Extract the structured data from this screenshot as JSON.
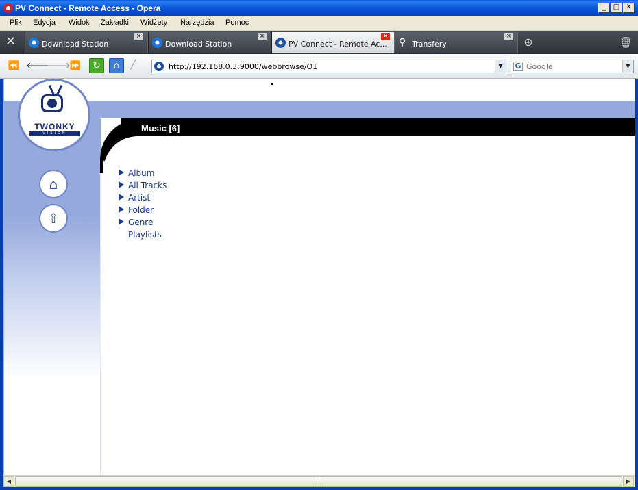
{
  "window": {
    "title": "PV Connect - Remote Access - Opera",
    "minimize_glyph": "_",
    "maximize_glyph": "□",
    "close_glyph": "✕"
  },
  "menu": [
    "Plik",
    "Edycja",
    "Widok",
    "Zakładki",
    "Widżety",
    "Narzędzia",
    "Pomoc"
  ],
  "tabs": [
    {
      "label": "Download Station",
      "icon": "globe-icon",
      "active": false
    },
    {
      "label": "Download Station",
      "icon": "globe-icon",
      "active": false
    },
    {
      "label": "PV Connect - Remote Ac...",
      "icon": "twonky-icon",
      "active": true
    },
    {
      "label": "Transfery",
      "icon": "satellite-icon",
      "active": false
    }
  ],
  "toolbar": {
    "address": "http://192.168.0.3:9000/webbrowse/O1",
    "search_placeholder": "Google",
    "search_engine_letter": "G"
  },
  "page": {
    "logo_text": "TWONKY",
    "logo_sub": "VISION",
    "section_title": "Music [6]",
    "items": [
      {
        "label": "Album",
        "has_arrow": true
      },
      {
        "label": "All Tracks",
        "has_arrow": true
      },
      {
        "label": "Artist",
        "has_arrow": true
      },
      {
        "label": "Folder",
        "has_arrow": true
      },
      {
        "label": "Genre",
        "has_arrow": true
      },
      {
        "label": "Playlists",
        "has_arrow": false
      }
    ]
  },
  "colors": {
    "titlebar": "#0c58d8",
    "sidebar_band": "#95a9dd",
    "link": "#1a3b91",
    "active_tab_close": "#e8271c"
  }
}
